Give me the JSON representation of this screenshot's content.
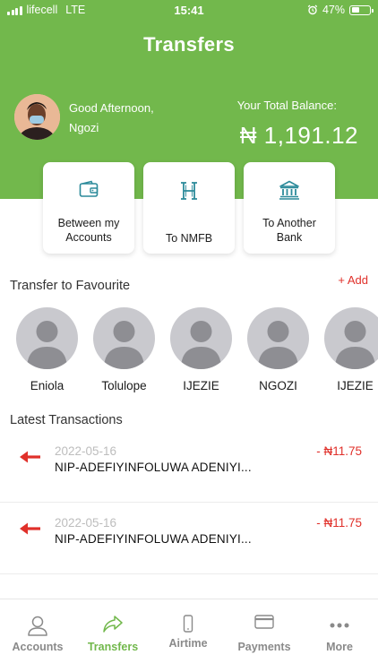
{
  "status_bar": {
    "carrier": "lifecell",
    "network": "LTE",
    "time": "15:41",
    "battery": "47%"
  },
  "header": {
    "title": "Transfers",
    "greeting": "Good Afternoon,",
    "user_name": "Ngozi",
    "balance_label": "Your Total Balance:",
    "balance_value": "₦ 1,191.12"
  },
  "actions": [
    {
      "label": "Between my Accounts",
      "icon": "wallet-icon"
    },
    {
      "label": "To NMFB",
      "icon": "nmfb-logo-icon"
    },
    {
      "label": "To Another Bank",
      "icon": "bank-icon"
    }
  ],
  "favourites": {
    "title": "Transfer to Favourite",
    "add_label": "+ Add",
    "people": [
      "Eniola",
      "Tolulope",
      "IJEZIE",
      "NGOZI",
      "IJEZIE"
    ]
  },
  "transactions": {
    "title": "Latest Transactions",
    "items": [
      {
        "date": "2022-05-16",
        "description": "NIP-ADEFIYINFOLUWA ADENIYI...",
        "amount": "- ₦11.75"
      },
      {
        "date": "2022-05-16",
        "description": "NIP-ADEFIYINFOLUWA ADENIYI...",
        "amount": "- ₦11.75"
      }
    ]
  },
  "tabs": [
    {
      "label": "Accounts",
      "icon": "person-icon"
    },
    {
      "label": "Transfers",
      "icon": "share-arrow-icon"
    },
    {
      "label": "Airtime",
      "icon": "phone-icon"
    },
    {
      "label": "Payments",
      "icon": "card-icon"
    },
    {
      "label": "More",
      "icon": "more-dots-icon"
    }
  ],
  "colors": {
    "brand_green": "#72b84c",
    "debit_red": "#e0302a"
  }
}
